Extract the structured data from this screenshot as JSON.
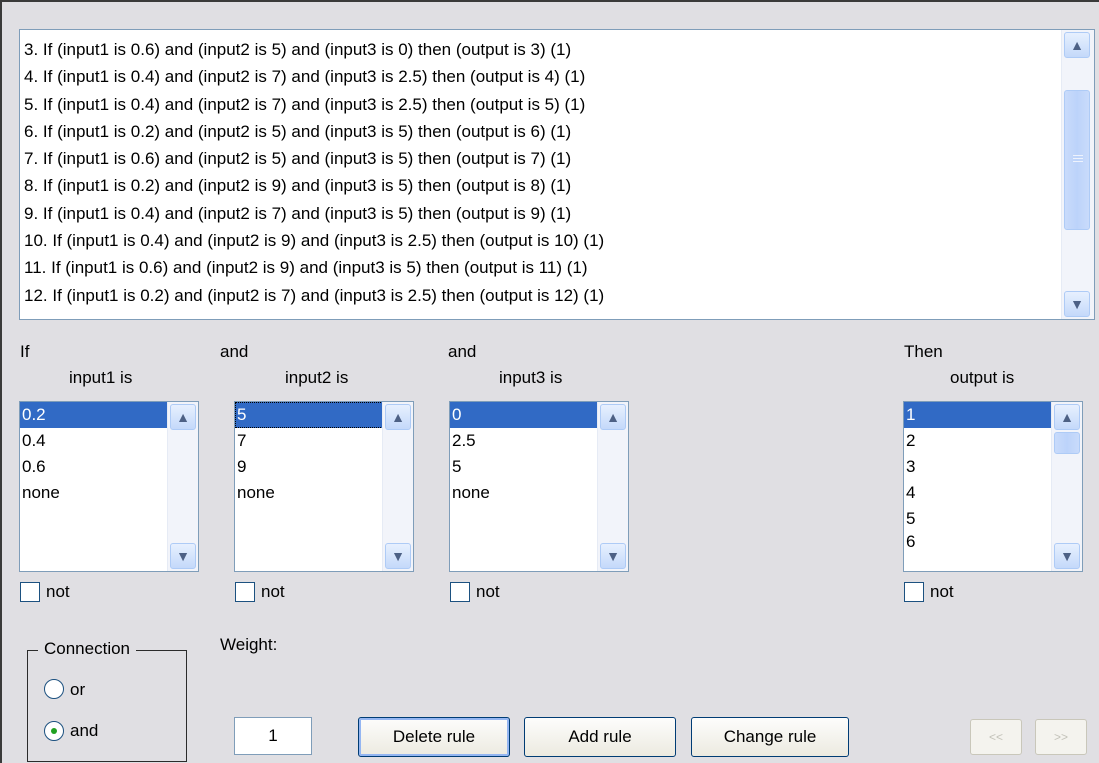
{
  "rules": [
    "3. If (input1 is 0.6) and (input2 is 5) and (input3 is 0) then (output is 3) (1)",
    "4. If (input1 is 0.4) and (input2 is 7) and (input3 is 2.5) then (output is 4) (1)",
    "5. If (input1 is 0.4) and (input2 is 7) and (input3 is 2.5) then (output is 5) (1)",
    "6. If (input1 is 0.2) and (input2 is 5) and (input3 is 5) then (output is 6) (1)",
    "7. If (input1 is 0.6) and (input2 is 5) and (input3 is 5) then (output is 7) (1)",
    "8. If (input1 is 0.2) and (input2 is 9) and (input3 is 5) then (output is 8) (1)",
    "9. If (input1 is 0.4) and (input2 is 7) and (input3 is 5) then (output is 9) (1)",
    "10. If (input1 is 0.4) and (input2 is 9) and (input3 is 2.5) then (output is 10) (1)",
    "11. If (input1 is 0.6) and (input2 is 9) and (input3 is 5) then (output is 11) (1)",
    "12. If (input1 is 0.2) and (input2 is 7) and (input3 is 2.5) then (output is 12) (1)"
  ],
  "labels": {
    "if": "If",
    "and1": "and",
    "and2": "and",
    "then": "Then",
    "input1_is": "input1 is",
    "input2_is": "input2 is",
    "input3_is": "input3 is",
    "output_is": "output is",
    "not": "not",
    "connection": "Connection",
    "or": "or",
    "and": "and",
    "weight": "Weight:"
  },
  "input1": {
    "options": [
      "0.2",
      "0.4",
      "0.6",
      "none"
    ],
    "selected": "0.2"
  },
  "input2": {
    "options": [
      "5",
      "7",
      "9",
      "none"
    ],
    "selected": "5"
  },
  "input3": {
    "options": [
      "0",
      "2.5",
      "5",
      "none"
    ],
    "selected": "0"
  },
  "output": {
    "options": [
      "1",
      "2",
      "3",
      "4",
      "5",
      "6"
    ],
    "selected": "1"
  },
  "not_checked": {
    "input1": false,
    "input2": false,
    "input3": false,
    "output": false
  },
  "connection_selected": "and",
  "weight_value": "1",
  "buttons": {
    "delete": "Delete rule",
    "add": "Add rule",
    "change": "Change rule",
    "prev": "<<",
    "next": ">>"
  },
  "colors": {
    "background": "#e0dfe3",
    "selection": "#316ac5",
    "border": "#7f9db9",
    "radio_dot": "#21a121"
  },
  "icons": [
    "scroll-up-arrow-icon",
    "scroll-down-arrow-icon",
    "scroll-thumb-grip-icon",
    "radio-dot-icon"
  ]
}
